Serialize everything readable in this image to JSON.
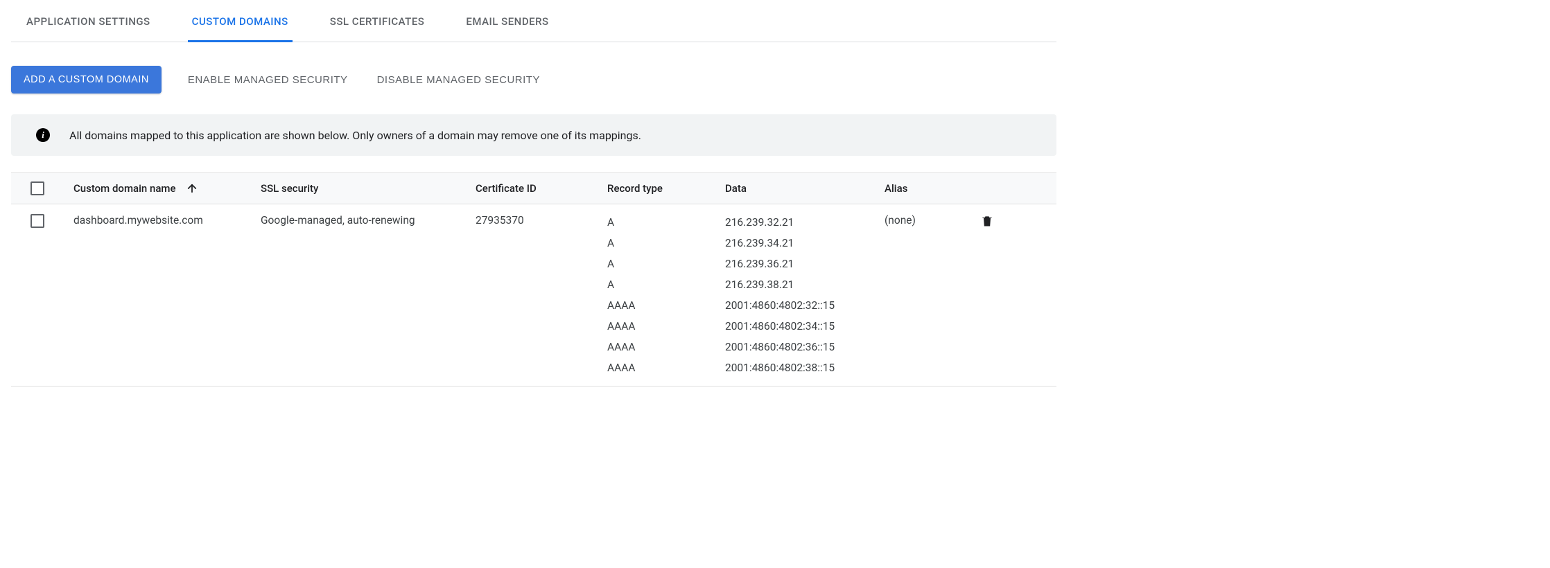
{
  "tabs": [
    {
      "label": "APPLICATION SETTINGS",
      "active": false
    },
    {
      "label": "CUSTOM DOMAINS",
      "active": true
    },
    {
      "label": "SSL CERTIFICATES",
      "active": false
    },
    {
      "label": "EMAIL SENDERS",
      "active": false
    }
  ],
  "actions": {
    "add": "ADD A CUSTOM DOMAIN",
    "enable_security": "ENABLE MANAGED SECURITY",
    "disable_security": "DISABLE MANAGED SECURITY"
  },
  "info": {
    "message": "All domains mapped to this application are shown below. Only owners of a domain may remove one of its mappings."
  },
  "table": {
    "headers": {
      "domain": "Custom domain name",
      "ssl": "SSL security",
      "cert": "Certificate ID",
      "rectype": "Record type",
      "data": "Data",
      "alias": "Alias"
    },
    "rows": [
      {
        "domain": "dashboard.mywebsite.com",
        "ssl": "Google-managed, auto-renewing",
        "cert": "27935370",
        "alias": "(none)",
        "records": [
          {
            "type": "A",
            "data": "216.239.32.21"
          },
          {
            "type": "A",
            "data": "216.239.34.21"
          },
          {
            "type": "A",
            "data": "216.239.36.21"
          },
          {
            "type": "A",
            "data": "216.239.38.21"
          },
          {
            "type": "AAAA",
            "data": "2001:4860:4802:32::15"
          },
          {
            "type": "AAAA",
            "data": "2001:4860:4802:34::15"
          },
          {
            "type": "AAAA",
            "data": "2001:4860:4802:36::15"
          },
          {
            "type": "AAAA",
            "data": "2001:4860:4802:38::15"
          }
        ]
      }
    ]
  }
}
